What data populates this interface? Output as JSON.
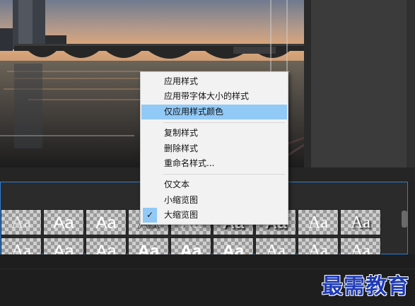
{
  "context_menu": {
    "items": [
      {
        "label": "应用样式"
      },
      {
        "label": "应用带字体大小的样式"
      },
      {
        "label": "仅应用样式颜色",
        "highlighted": true
      },
      {
        "label": "复制样式"
      },
      {
        "label": "删除样式"
      },
      {
        "label": "重命名样式..."
      },
      {
        "label": "仅文本"
      },
      {
        "label": "小缩览图"
      },
      {
        "label": "大缩览图",
        "checked": true
      }
    ],
    "check_glyph": "✓",
    "highlight_color": "#91c9f7"
  },
  "styles_panel": {
    "thumbnail_text": "Aa",
    "border_color": "#2f7fd0"
  },
  "watermark": {
    "text": "最需教育",
    "color": "#1f3bb7"
  },
  "icons": [
    "checkmark-icon"
  ]
}
